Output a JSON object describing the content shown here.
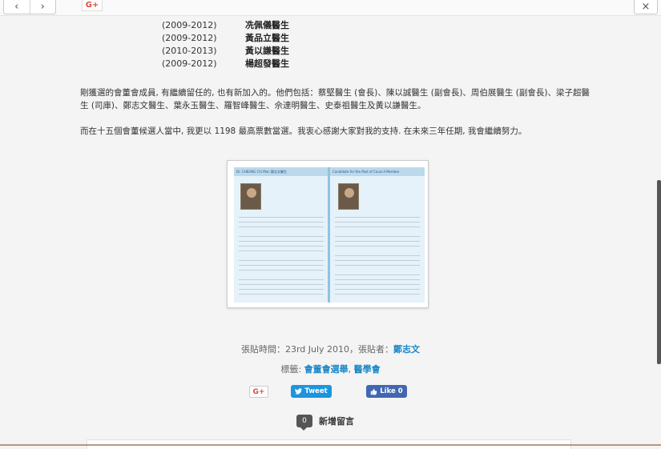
{
  "toolbar": {
    "back_icon": "‹",
    "forward_icon": "›",
    "gplus_label": "G+",
    "close_icon": "×"
  },
  "council": [
    {
      "years": "(2009-2012)",
      "name": "冼佩儀醫生"
    },
    {
      "years": "(2009-2012)",
      "name": "黃品立醫生"
    },
    {
      "years": "(2010-2013)",
      "name": "黃以謙醫生"
    },
    {
      "years": "(2009-2012)",
      "name": "楊超發醫生"
    }
  ],
  "paragraphs": {
    "p1": "剛獲選的會董會成員, 有繼續留任的, 也有新加入的。他們包括：蔡堅醫生 (會長)、陳以誠醫生 (副會長)、周伯展醫生 (副會長)、梁子超醫生 (司庫)、鄭志文醫生、葉永玉醫生、羅智峰醫生、佘達明醫生、史泰祖醫生及黃以謙醫生。",
    "p2": "而在十五個會董候選人當中, 我更以 1198 最高票數當選。我衷心感謝大家對我的支持. 在未來三年任期, 我會繼續努力。"
  },
  "figure": {
    "left_title": "Dr. CHEUNG Chi Man   鄭志文醫生",
    "right_title": "Candidate for the Post of Council Member"
  },
  "meta": {
    "posted_prefix": "張貼時間：23rd July 2010，張貼者：",
    "author": "鄭志文",
    "tags_prefix": "標籤: ",
    "tag1": "會董會選舉",
    "tag_sep": ", ",
    "tag2": "醫學會"
  },
  "share": {
    "gplus": "G+",
    "tweet": "Tweet",
    "like": "Like",
    "like_count": "0"
  },
  "comments": {
    "count": "0",
    "label": "新增留言"
  }
}
